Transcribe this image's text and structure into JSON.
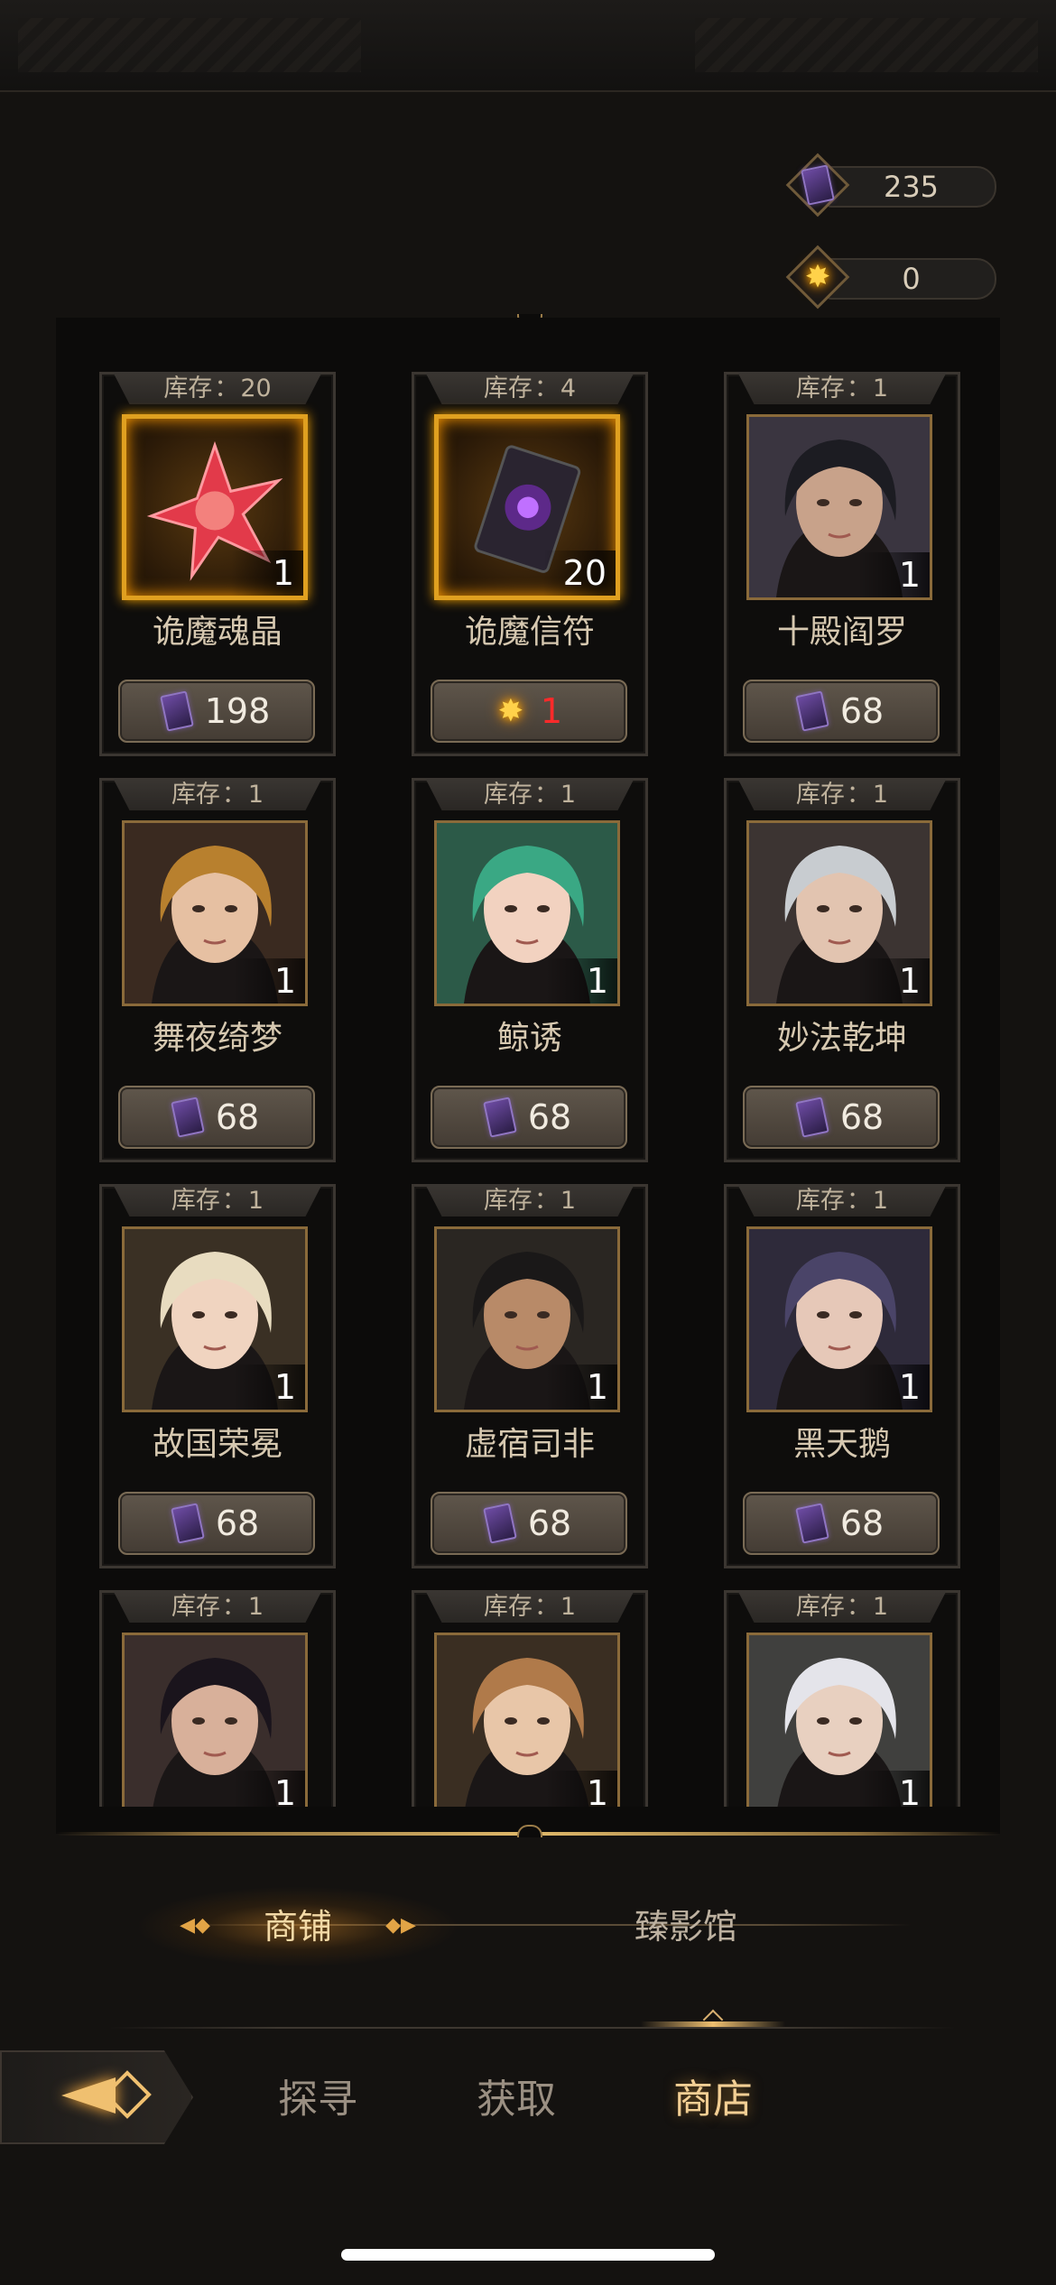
{
  "currencies": [
    {
      "icon": "purple-card-icon",
      "value": "235"
    },
    {
      "icon": "gold-star-icon",
      "value": "0"
    }
  ],
  "items": [
    {
      "stock_label": "库存",
      "stock": "20",
      "qty": "1",
      "name": "诡魔魂晶",
      "price_icon": "purple-card-icon",
      "price": "198",
      "legendary": true,
      "art": "red-star"
    },
    {
      "stock_label": "库存",
      "stock": "4",
      "qty": "20",
      "name": "诡魔信符",
      "price_icon": "gold-star-icon",
      "price": "1",
      "price_red": true,
      "legendary": true,
      "art": "card"
    },
    {
      "stock_label": "库存",
      "stock": "1",
      "qty": "1",
      "name": "十殿阎罗",
      "price_icon": "purple-card-icon",
      "price": "68",
      "art": "portrait",
      "hair": "#1c1c22",
      "skin": "#c8a28a",
      "bg": "#3a3540"
    },
    {
      "stock_label": "库存",
      "stock": "1",
      "qty": "1",
      "name": "舞夜绮梦",
      "price_icon": "purple-card-icon",
      "price": "68",
      "art": "portrait",
      "hair": "#b8802e",
      "skin": "#e6c0a2",
      "bg": "#3a2a20"
    },
    {
      "stock_label": "库存",
      "stock": "1",
      "qty": "1",
      "name": "鲸诱",
      "price_icon": "purple-card-icon",
      "price": "68",
      "art": "portrait",
      "hair": "#3aa884",
      "skin": "#f2d2c0",
      "bg": "#2c5a48"
    },
    {
      "stock_label": "库存",
      "stock": "1",
      "qty": "1",
      "name": "妙法乾坤",
      "price_icon": "purple-card-icon",
      "price": "68",
      "art": "portrait",
      "hair": "#c8ccd0",
      "skin": "#e2c4b0",
      "bg": "#3c3432"
    },
    {
      "stock_label": "库存",
      "stock": "1",
      "qty": "1",
      "name": "故国荣冕",
      "price_icon": "purple-card-icon",
      "price": "68",
      "art": "portrait",
      "hair": "#e8dcc0",
      "skin": "#f0d4c0",
      "bg": "#3a3024"
    },
    {
      "stock_label": "库存",
      "stock": "1",
      "qty": "1",
      "name": "虚宿司非",
      "price_icon": "purple-card-icon",
      "price": "68",
      "art": "portrait",
      "hair": "#1a1818",
      "skin": "#b88a68",
      "bg": "#2a2622"
    },
    {
      "stock_label": "库存",
      "stock": "1",
      "qty": "1",
      "name": "黑天鹅",
      "price_icon": "purple-card-icon",
      "price": "68",
      "art": "portrait",
      "hair": "#4a4468",
      "skin": "#e6c8b8",
      "bg": "#2e2a3a"
    },
    {
      "stock_label": "库存",
      "stock": "1",
      "qty": "1",
      "name": "",
      "price_icon": "purple-card-icon",
      "price": "",
      "art": "portrait",
      "hair": "#1a141c",
      "skin": "#d8b09a",
      "bg": "#3a2e2c"
    },
    {
      "stock_label": "库存",
      "stock": "1",
      "qty": "1",
      "name": "",
      "price_icon": "purple-card-icon",
      "price": "",
      "art": "portrait",
      "hair": "#b07a4a",
      "skin": "#e8c6a8",
      "bg": "#3a2e22"
    },
    {
      "stock_label": "库存",
      "stock": "1",
      "qty": "1",
      "name": "",
      "price_icon": "purple-card-icon",
      "price": "",
      "art": "portrait",
      "hair": "#e4e4ea",
      "skin": "#e8d0c0",
      "bg": "#40403e"
    }
  ],
  "tabs": [
    {
      "label": "商铺",
      "active": true
    },
    {
      "label": "臻影馆",
      "active": false
    }
  ],
  "nav": [
    {
      "label": "探寻",
      "active": false
    },
    {
      "label": "获取",
      "active": false
    },
    {
      "label": "商店",
      "active": true
    }
  ]
}
